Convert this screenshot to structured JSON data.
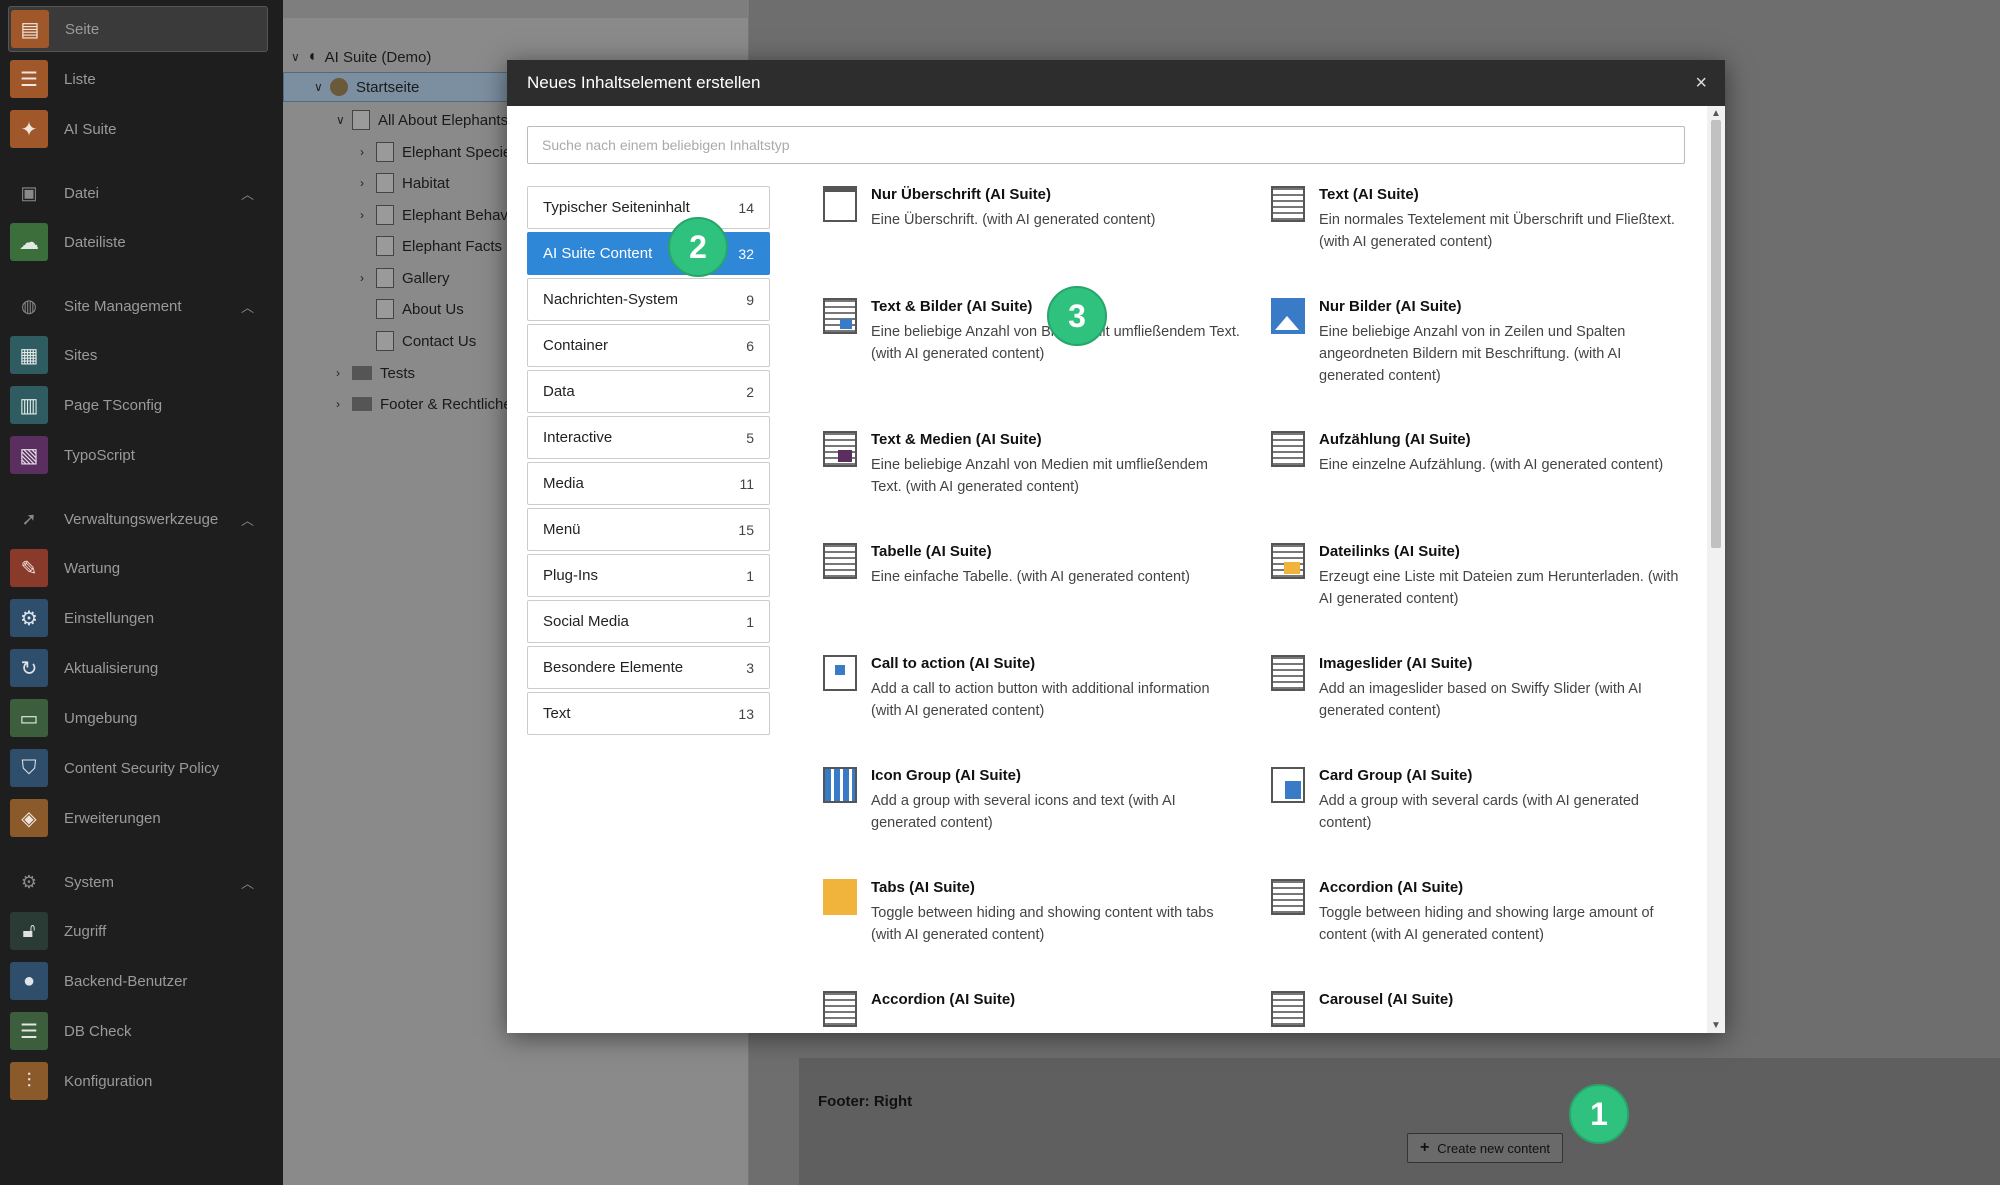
{
  "sidebar": {
    "items": [
      {
        "label": "Seite",
        "icon": "page-icon",
        "color": "#a0582a",
        "active": true
      },
      {
        "label": "Liste",
        "icon": "list-icon",
        "color": "#a0582a"
      },
      {
        "label": "AI Suite",
        "icon": "sparkle-icon",
        "color": "#a0582a"
      },
      {
        "label": "Dateiliste",
        "icon": "cloud-icon",
        "color": "#3c6e3c"
      },
      {
        "label": "Sites",
        "icon": "sites-icon",
        "color": "#2f5c60"
      },
      {
        "label": "Page TSconfig",
        "icon": "tsconfig-icon",
        "color": "#2f5c60"
      },
      {
        "label": "TypoScript",
        "icon": "typoscript-icon",
        "color": "#5a2f60"
      },
      {
        "label": "Wartung",
        "icon": "wrench-icon",
        "color": "#8a3a2a"
      },
      {
        "label": "Einstellungen",
        "icon": "gear-icon",
        "color": "#2f4e6c"
      },
      {
        "label": "Aktualisierung",
        "icon": "refresh-icon",
        "color": "#2f4e6c"
      },
      {
        "label": "Umgebung",
        "icon": "monitor-icon",
        "color": "#3c5e3c"
      },
      {
        "label": "Content Security Policy",
        "icon": "shield-icon",
        "color": "#2f4e6c"
      },
      {
        "label": "Erweiterungen",
        "icon": "box-icon",
        "color": "#8a5a2a"
      },
      {
        "label": "Zugriff",
        "icon": "lock-icon",
        "color": "#2a3a34"
      },
      {
        "label": "Backend-Benutzer",
        "icon": "user-icon",
        "color": "#2f4e6c"
      },
      {
        "label": "DB Check",
        "icon": "database-icon",
        "color": "#3c5e3c"
      },
      {
        "label": "Konfiguration",
        "icon": "sliders-icon",
        "color": "#8a5a2a"
      }
    ],
    "groups": [
      {
        "label": "Datei",
        "icon": "image-icon"
      },
      {
        "label": "Site Management",
        "icon": "globe-icon"
      },
      {
        "label": "Verwaltungswerkzeuge",
        "icon": "rocket-icon"
      },
      {
        "label": "System",
        "icon": "cog-icon"
      }
    ]
  },
  "tree": {
    "root": "AI Suite (Demo)",
    "nodes": [
      {
        "label": "Startseite",
        "selected": true
      },
      {
        "label": "All About Elephants"
      },
      {
        "label": "Elephant Species"
      },
      {
        "label": "Habitat"
      },
      {
        "label": "Elephant Behavior"
      },
      {
        "label": "Elephant Facts"
      },
      {
        "label": "Gallery"
      },
      {
        "label": "About Us"
      },
      {
        "label": "Contact Us"
      },
      {
        "label": "Tests"
      },
      {
        "label": "Footer & Rechtliches"
      }
    ]
  },
  "main": {
    "footer_title": "Footer: Right",
    "create_label": "Create new content"
  },
  "badges": {
    "b1": "1",
    "b2": "2",
    "b3": "3"
  },
  "modal": {
    "title": "Neues Inhaltselement erstellen",
    "close": "×",
    "search_placeholder": "Suche nach einem beliebigen Inhaltstyp",
    "categories": [
      {
        "label": "Typischer Seiteninhalt",
        "count": "14"
      },
      {
        "label": "AI Suite Content",
        "count": "32",
        "active": true
      },
      {
        "label": "Nachrichten-System",
        "count": "9"
      },
      {
        "label": "Container",
        "count": "6"
      },
      {
        "label": "Data",
        "count": "2"
      },
      {
        "label": "Interactive",
        "count": "5"
      },
      {
        "label": "Media",
        "count": "11"
      },
      {
        "label": "Menü",
        "count": "15"
      },
      {
        "label": "Plug-Ins",
        "count": "1"
      },
      {
        "label": "Social Media",
        "count": "1"
      },
      {
        "label": "Besondere Elemente",
        "count": "3"
      },
      {
        "label": "Text",
        "count": "13"
      }
    ],
    "items": [
      {
        "title": "Nur Überschrift (AI Suite)",
        "desc": "Eine Überschrift. (with AI generated content)"
      },
      {
        "title": "Text (AI Suite)",
        "desc": "Ein normales Textelement mit Überschrift und Fließtext. (with AI generated content)"
      },
      {
        "title": "Text & Bilder (AI Suite)",
        "desc": "Eine beliebige Anzahl von Bildern mit umfließendem Text. (with AI generated content)"
      },
      {
        "title": "Nur Bilder (AI Suite)",
        "desc": "Eine beliebige Anzahl von in Zeilen und Spalten angeordneten Bildern mit Beschriftung. (with AI generated content)"
      },
      {
        "title": "Text & Medien (AI Suite)",
        "desc": "Eine beliebige Anzahl von Medien mit umfließendem Text. (with AI generated content)"
      },
      {
        "title": "Aufzählung (AI Suite)",
        "desc": "Eine einzelne Aufzählung. (with AI generated content)"
      },
      {
        "title": "Tabelle (AI Suite)",
        "desc": "Eine einfache Tabelle. (with AI generated content)"
      },
      {
        "title": "Dateilinks (AI Suite)",
        "desc": "Erzeugt eine Liste mit Dateien zum Herunterladen. (with AI generated content)"
      },
      {
        "title": "Call to action (AI Suite)",
        "desc": "Add a call to action button with additional information (with AI generated content)"
      },
      {
        "title": "Imageslider (AI Suite)",
        "desc": "Add an imageslider based on Swiffy Slider (with AI generated content)"
      },
      {
        "title": "Icon Group (AI Suite)",
        "desc": "Add a group with several icons and text (with AI generated content)"
      },
      {
        "title": "Card Group (AI Suite)",
        "desc": "Add a group with several cards (with AI generated content)"
      },
      {
        "title": "Tabs (AI Suite)",
        "desc": "Toggle between hiding and showing content with tabs (with AI generated content)"
      },
      {
        "title": "Accordion (AI Suite)",
        "desc": "Toggle between hiding and showing large amount of content (with AI generated content)"
      },
      {
        "title": "Accordion (AI Suite)",
        "desc": ""
      },
      {
        "title": "Carousel (AI Suite)",
        "desc": ""
      }
    ]
  }
}
